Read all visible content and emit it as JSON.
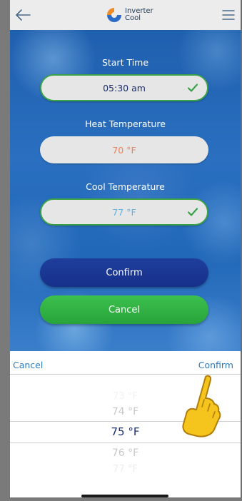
{
  "header": {
    "logo_line1": "Inverter",
    "logo_line2": "Cool",
    "back_icon": "arrow-left-icon",
    "menu_icon": "hamburger-menu-icon"
  },
  "form": {
    "start_time_label": "Start Time",
    "start_time_value": "05:30 am",
    "heat_label": "Heat Temperature",
    "heat_value": "70 °F",
    "cool_label": "Cool Temperature",
    "cool_value": "77 °F",
    "confirm_button": "Confirm",
    "cancel_button": "Cancel"
  },
  "picker": {
    "cancel_label": "Cancel",
    "confirm_label": "Confirm",
    "options": [
      "73 °F",
      "74 °F",
      "75 °F",
      "76 °F",
      "77 °F"
    ],
    "selected_index": 2
  },
  "colors": {
    "heat_value": "#e8835a",
    "cool_value": "#5fb3e0",
    "start_value": "#1a2f6e",
    "check": "#3aa34a",
    "confirm_button": "#1c3a96",
    "cancel_button": "#32b445",
    "link": "#2e79b8"
  }
}
